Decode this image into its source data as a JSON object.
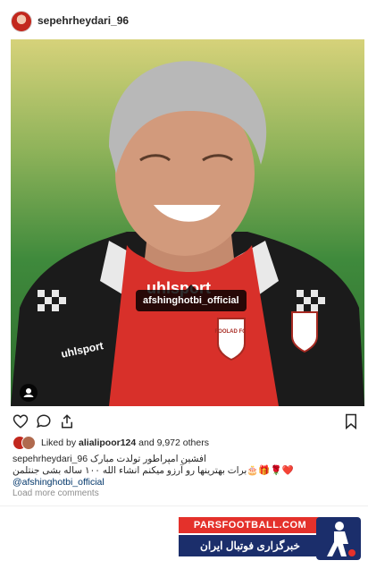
{
  "post": {
    "username": "sepehrheydari_96",
    "photo_tag": "afshinghotbi_official",
    "shirt_text": "uhlsport",
    "sleeve_text": "uhlsport",
    "badge_text": "FOOLAD FC"
  },
  "likes": {
    "text_prefix": "Liked by ",
    "liker": "alialipoor124",
    "text_suffix": " and 9,972 others"
  },
  "caption": {
    "username": "sepehrheydari_96",
    "line1": "افشین امپراطور تولدت مبارک",
    "line2": "❤️🌹🎁🎂برات بهترینها رو آرزو میکنم انشاء الله ۱۰۰ ساله بشی جنتلمن",
    "mention": "@afshinghotbi_official"
  },
  "load_more": "Load more comments",
  "banner": {
    "top": "PARSFOOTBALL.COM",
    "bottom": "خبرگزاری فوتبال ایران"
  },
  "colors": {
    "banner_red": "#e4312b",
    "banner_navy": "#1b2e6b",
    "mention_blue": "#003569",
    "shirt_red": "#d8302a"
  },
  "icons": [
    "heart-icon",
    "comment-icon",
    "share-icon",
    "bookmark-icon",
    "tag-user-icon"
  ]
}
